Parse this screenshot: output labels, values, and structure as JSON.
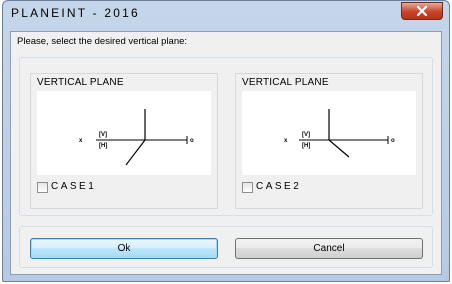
{
  "window": {
    "title": "PLANEINT - 2016"
  },
  "prompt": "Please, select the desired vertical plane:",
  "panels": [
    {
      "heading": "VERTICAL PLANE",
      "case_label": "CASE1",
      "checked": false,
      "diagram": {
        "x_label": "x",
        "upper_label": "[V]",
        "lower_label": "[H]",
        "o_label": "o"
      }
    },
    {
      "heading": "VERTICAL PLANE",
      "case_label": "CASE2",
      "checked": false,
      "diagram": {
        "x_label": "x",
        "upper_label": "[V]",
        "lower_label": "[H]",
        "o_label": "o"
      }
    }
  ],
  "buttons": {
    "ok": "Ok",
    "cancel": "Cancel"
  },
  "colors": {
    "close_button": "#c8442b",
    "default_button_border": "#3c7fb1",
    "titlebar": "#c5d6ea"
  }
}
